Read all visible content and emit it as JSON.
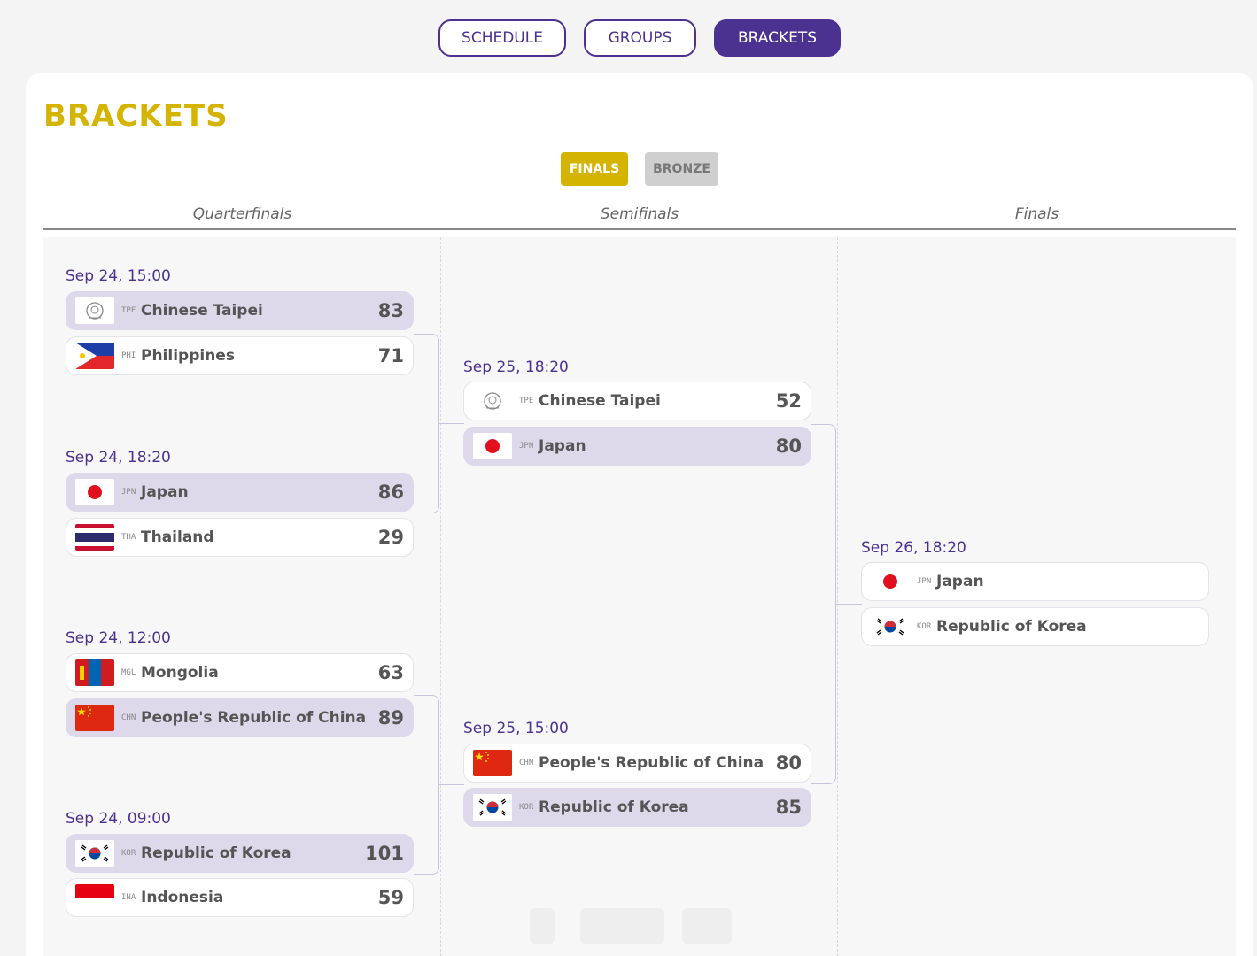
{
  "nav": {
    "schedule": "SCHEDULE",
    "groups": "GROUPS",
    "brackets": "BRACKETS"
  },
  "page_title": "BRACKETS",
  "tabs": {
    "finals": "FINALS",
    "bronze": "BRONZE"
  },
  "rounds": {
    "quarterfinals": "Quarterfinals",
    "semifinals": "Semifinals",
    "finals": "Finals"
  },
  "matches": {
    "qf1": {
      "date": "Sep 24, 15:00",
      "t1": {
        "code": "TPE",
        "name": "Chinese Taipei",
        "score": "83"
      },
      "t2": {
        "code": "PHI",
        "name": "Philippines",
        "score": "71"
      }
    },
    "qf2": {
      "date": "Sep 24, 18:20",
      "t1": {
        "code": "JPN",
        "name": "Japan",
        "score": "86"
      },
      "t2": {
        "code": "THA",
        "name": "Thailand",
        "score": "29"
      }
    },
    "qf3": {
      "date": "Sep 24, 12:00",
      "t1": {
        "code": "MGL",
        "name": "Mongolia",
        "score": "63"
      },
      "t2": {
        "code": "CHN",
        "name": "People's Republic of China",
        "score": "89"
      }
    },
    "qf4": {
      "date": "Sep 24, 09:00",
      "t1": {
        "code": "KOR",
        "name": "Republic of Korea",
        "score": "101"
      },
      "t2": {
        "code": "INA",
        "name": "Indonesia",
        "score": "59"
      }
    },
    "sf1": {
      "date": "Sep 25, 18:20",
      "t1": {
        "code": "TPE",
        "name": "Chinese Taipei",
        "score": "52"
      },
      "t2": {
        "code": "JPN",
        "name": "Japan",
        "score": "80"
      }
    },
    "sf2": {
      "date": "Sep 25, 15:00",
      "t1": {
        "code": "CHN",
        "name": "People's Republic of China",
        "score": "80"
      },
      "t2": {
        "code": "KOR",
        "name": "Republic of Korea",
        "score": "85"
      }
    },
    "final": {
      "date": "Sep 26, 18:20",
      "t1": {
        "code": "JPN",
        "name": "Japan",
        "score": ""
      },
      "t2": {
        "code": "KOR",
        "name": "Republic of Korea",
        "score": ""
      }
    }
  },
  "colors": {
    "accent": "#4b3291",
    "title": "#d4b400",
    "winner_bg": "#ddd8ea"
  }
}
